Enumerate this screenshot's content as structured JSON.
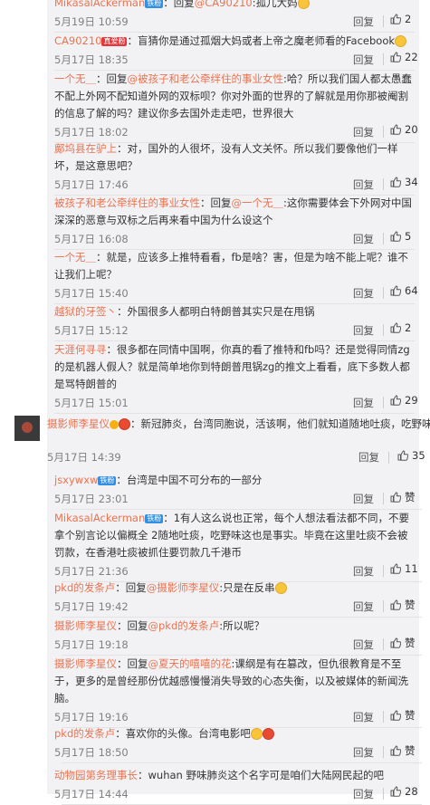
{
  "top_comments": [
    {
      "user": "MikasalAckerman",
      "badge": "铁粉",
      "segments": [
        {
          "t": "：回复",
          "c": ""
        },
        {
          "t": "@CA90210",
          "c": "user"
        },
        {
          "t": ":孤儿大妈",
          "c": ""
        }
      ],
      "time": "5月19日 10:59",
      "reply": "回复",
      "likes": "2"
    },
    {
      "user": "CA90210",
      "badge": "真爱粉",
      "segments": [
        {
          "t": "：盲猜你是通过孤烟大妈或者上帝之魔老师看的Facebook",
          "c": ""
        }
      ],
      "time": "5月17日 18:35",
      "reply": "回复",
      "likes": "22"
    },
    {
      "user": "一个无＿",
      "segments": [
        {
          "t": "：回复",
          "c": ""
        },
        {
          "t": "@被孩子和老公牵绊住的事业女性",
          "c": "user"
        },
        {
          "t": ":哈？所以我们国人都太愚蠢不配上外网不配知道外网的双标呗？你对外面的世界的了解就是用你那被阉割的信息了解的吗？建议你多去国外走走吧，世界很大",
          "c": ""
        }
      ],
      "time": "5月17日 18:02",
      "reply": "回复",
      "likes": "20"
    },
    {
      "user": "鄺坞县在驴上",
      "segments": [
        {
          "t": "：对，国外的人很坏，没有人文关怀。所以我们要像他们一样坏，是这意思吧？",
          "c": ""
        }
      ],
      "time": "5月17日 17:46",
      "reply": "回复",
      "likes": "34"
    },
    {
      "user": "被孩子和老公牵绊住的事业女性",
      "segments": [
        {
          "t": "：回复",
          "c": ""
        },
        {
          "t": "@一个无＿",
          "c": "user"
        },
        {
          "t": ":这你需要体会下外网对中国深深的恶意与双标之后再来看中国为什么设这个",
          "c": ""
        }
      ],
      "time": "5月17日 16:08",
      "reply": "回复",
      "likes": "5"
    },
    {
      "user": "一个无＿",
      "segments": [
        {
          "t": "：就是，应该多上推特看看，fb是啥？害，但是为啥不能上呢？谁不让我们上呢？",
          "c": ""
        }
      ],
      "time": "5月17日 15:40",
      "reply": "回复",
      "likes": "64"
    },
    {
      "user": "越狱的牙签丶",
      "segments": [
        {
          "t": "：外国很多人都明白特朗普其实只是在甩锅",
          "c": ""
        }
      ],
      "time": "5月17日 15:12",
      "reply": "回复",
      "likes": "2"
    },
    {
      "user": "天涯何寻寻",
      "segments": [
        {
          "t": "：很多都在同情中国啊，你真的看了推特和fb吗？还是觉得同情zg的是机器人假人？就是简单地你到特朗普甩锅zg的推文上看看，底下多数人都是骂特朗普的",
          "c": ""
        }
      ],
      "time": "5月17日 15:01",
      "reply": "回复",
      "likes": "29"
    }
  ],
  "main_comment": {
    "user": "摄影师李星仪",
    "text": "：新冠肺炎，台湾同胞说，活该啊，他们就知道随地吐痰，吃野味。",
    "time": "5月17日 14:39",
    "reply": "回复",
    "likes": "35"
  },
  "sub_comments": [
    {
      "user": "jsxywxw",
      "badge": "铁粉",
      "segments": [
        {
          "t": "：台湾是中国不可分布的一部分",
          "c": ""
        }
      ],
      "time": "5月17日 23:01",
      "reply": "回复",
      "likes": "赞"
    },
    {
      "user": "MikasalAckerman",
      "badge": "铁粉",
      "segments": [
        {
          "t": "：1有人这么说也正常，每个人想法看法都不同，不要拿个别言论以偏概全 2随地吐痰，吃野味这也是事实。毕竟在这里吐痰不会被罚款，在香港吐痰被抓住要罚款几千港币",
          "c": ""
        }
      ],
      "time": "5月17日 21:36",
      "reply": "回复",
      "likes": "11"
    },
    {
      "user": "pkd的发条卢",
      "segments": [
        {
          "t": "：回复",
          "c": ""
        },
        {
          "t": "@摄影师李星仪",
          "c": "user"
        },
        {
          "t": ":只是在反串",
          "c": ""
        }
      ],
      "time": "5月17日 19:42",
      "reply": "回复",
      "likes": "赞"
    },
    {
      "user": "摄影师李星仪",
      "segments": [
        {
          "t": "：回复",
          "c": ""
        },
        {
          "t": "@pkd的发条卢",
          "c": "user"
        },
        {
          "t": ":所以呢？",
          "c": ""
        }
      ],
      "time": "5月17日 19:18",
      "reply": "回复",
      "likes": "赞"
    },
    {
      "user": "摄影师李星仪",
      "segments": [
        {
          "t": "：回复",
          "c": ""
        },
        {
          "t": "@夏天的嘻嘻的花",
          "c": "user"
        },
        {
          "t": ":课纲是有在篡改，但仇很教育是不至于，更多的是曾经那份优越感慢慢消失导致的心态失衡，以及被媒体的新闻洗脑。",
          "c": ""
        }
      ],
      "time": "5月17日 19:16",
      "reply": "回复",
      "likes": "赞"
    },
    {
      "user": "pkd的发条卢",
      "segments": [
        {
          "t": "：喜欢你的头像。台湾电影吧",
          "c": ""
        }
      ],
      "time": "5月17日 18:50",
      "reply": "回复",
      "likes": "赞"
    },
    {
      "user": "动物园第务理事长",
      "segments": [
        {
          "t": "：wuhan 野味肺炎这个名字可是咱们大陆网民起的吧",
          "c": ""
        }
      ],
      "time": "5月17日 14:44",
      "reply": "回复",
      "likes": "28"
    }
  ],
  "colors": {
    "username": "#eb7350",
    "text": "#333333",
    "meta": "#808080",
    "panel_bg": "#f2f2f5"
  },
  "icons": {
    "like": "thumbs-up-icon",
    "emoji": "smiley-emoji-icon"
  }
}
